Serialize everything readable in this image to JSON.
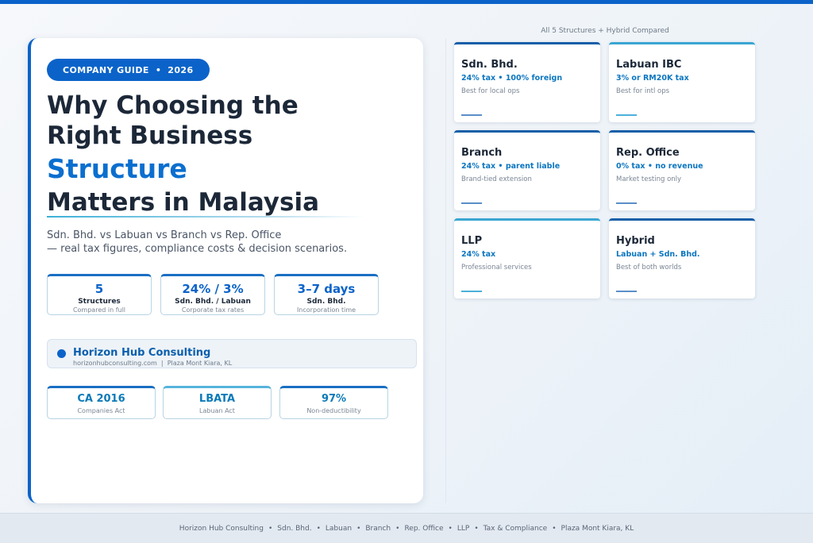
{
  "badge": {
    "label": "COMPANY GUIDE",
    "sep": "•",
    "year": "2026"
  },
  "headline": {
    "line1": "Why Choosing the",
    "line2": "Right Business",
    "line3": "Structure",
    "line4": "Matters in Malaysia"
  },
  "subtitle": {
    "line1": "Sdn. Bhd. vs Labuan vs Branch vs Rep. Office",
    "line2": "— real tax figures, compliance costs & decision scenarios."
  },
  "stats": [
    {
      "value": "5",
      "name": "Structures",
      "sub": "Compared in full"
    },
    {
      "value": "24% / 3%",
      "name": "Sdn. Bhd. / Labuan",
      "sub": "Corporate tax rates"
    },
    {
      "value": "3–7 days",
      "name": "Sdn. Bhd.",
      "sub": "Incorporation time"
    }
  ],
  "brand": {
    "name": "Horizon Hub Consulting",
    "website": "horizonhubconsulting.com",
    "sep": "|",
    "location": "Plaza Mont Kiara, KL"
  },
  "laws": [
    {
      "value": "CA 2016",
      "sub": "Companies Act"
    },
    {
      "value": "LBATA",
      "sub": "Labuan Act"
    },
    {
      "value": "97%",
      "sub": "Non-deductibility"
    }
  ],
  "grid": {
    "caption": "All 5 Structures + Hybrid Compared",
    "tiles": [
      {
        "title": "Sdn. Bhd.",
        "key": "24% tax • 100% foreign",
        "desc": "Best for local ops"
      },
      {
        "title": "Labuan IBC",
        "key": "3% or RM20K tax",
        "desc": "Best for intl ops"
      },
      {
        "title": "Branch",
        "key": "24% tax • parent liable",
        "desc": "Brand-tied extension"
      },
      {
        "title": "Rep. Office",
        "key": "0% tax • no revenue",
        "desc": "Market testing only"
      },
      {
        "title": "LLP",
        "key": "24% tax",
        "desc": "Professional services"
      },
      {
        "title": "Hybrid",
        "key": "Labuan + Sdn. Bhd.",
        "desc": "Best of both worlds"
      }
    ]
  },
  "footer": {
    "separator": "•",
    "items": [
      "Horizon Hub Consulting",
      "Sdn. Bhd.",
      "Labuan",
      "Branch",
      "Rep. Office",
      "LLP",
      "Tax & Compliance",
      "Plaza Mont Kiara, KL"
    ]
  },
  "colors": {
    "accent": "#0b63c9",
    "accent_light": "#3aa6d2",
    "text_dark": "#1c2838"
  }
}
